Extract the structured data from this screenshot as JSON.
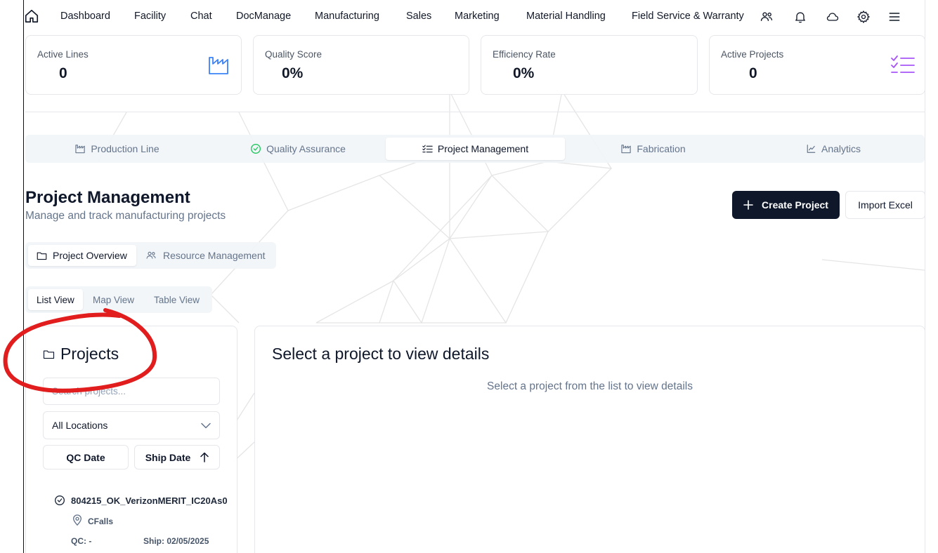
{
  "nav": {
    "items": [
      "Dashboard",
      "Facility",
      "Chat",
      "DocManage",
      "Manufacturing",
      "Sales",
      "Marketing",
      "Material Handling",
      "Field Service & Warranty"
    ],
    "icons": [
      "home-icon",
      "users-icon",
      "bell-icon",
      "cloud-icon",
      "gear-icon",
      "menu-icon"
    ]
  },
  "stats": [
    {
      "label": "Active Lines",
      "value": "0",
      "icon": "factory-icon",
      "icon_color": "#3b82f6"
    },
    {
      "label": "Quality Score",
      "value": "0%"
    },
    {
      "label": "Efficiency Rate",
      "value": "0%"
    },
    {
      "label": "Active Projects",
      "value": "0",
      "icon": "checklist-icon",
      "icon_color": "#a855f7"
    }
  ],
  "module_tabs": [
    {
      "label": "Production Line",
      "icon": "factory-icon"
    },
    {
      "label": "Quality Assurance",
      "icon": "check-circle-icon",
      "icon_color": "#22c55e"
    },
    {
      "label": "Project Management",
      "icon": "list-check-icon",
      "active": true
    },
    {
      "label": "Fabrication",
      "icon": "factory-icon"
    },
    {
      "label": "Analytics",
      "icon": "line-chart-icon"
    }
  ],
  "header": {
    "title": "Project Management",
    "subtitle": "Manage and track manufacturing projects",
    "create_label": "Create Project",
    "import_label": "Import Excel"
  },
  "sub_tabs": [
    {
      "label": "Project Overview",
      "icon": "folder-icon",
      "active": true
    },
    {
      "label": "Resource Management",
      "icon": "users-icon"
    }
  ],
  "view_tabs": [
    {
      "label": "List View",
      "active": true
    },
    {
      "label": "Map View"
    },
    {
      "label": "Table View"
    }
  ],
  "projects_panel": {
    "title": "Projects",
    "search_placeholder": "Search projects...",
    "location_selected": "All Locations",
    "sort_qc_label": "QC Date",
    "sort_ship_label": "Ship Date",
    "items": [
      {
        "name": "804215_OK_VerizonMERIT_IC20As0",
        "location": "CFalls",
        "qc": "QC: -",
        "ship": "Ship: 02/05/2025"
      }
    ]
  },
  "details_panel": {
    "title": "Select a project to view details",
    "hint": "Select a project from the list to view details"
  },
  "colors": {
    "primary": "#0f172a",
    "annotation": "#e11d1d"
  }
}
